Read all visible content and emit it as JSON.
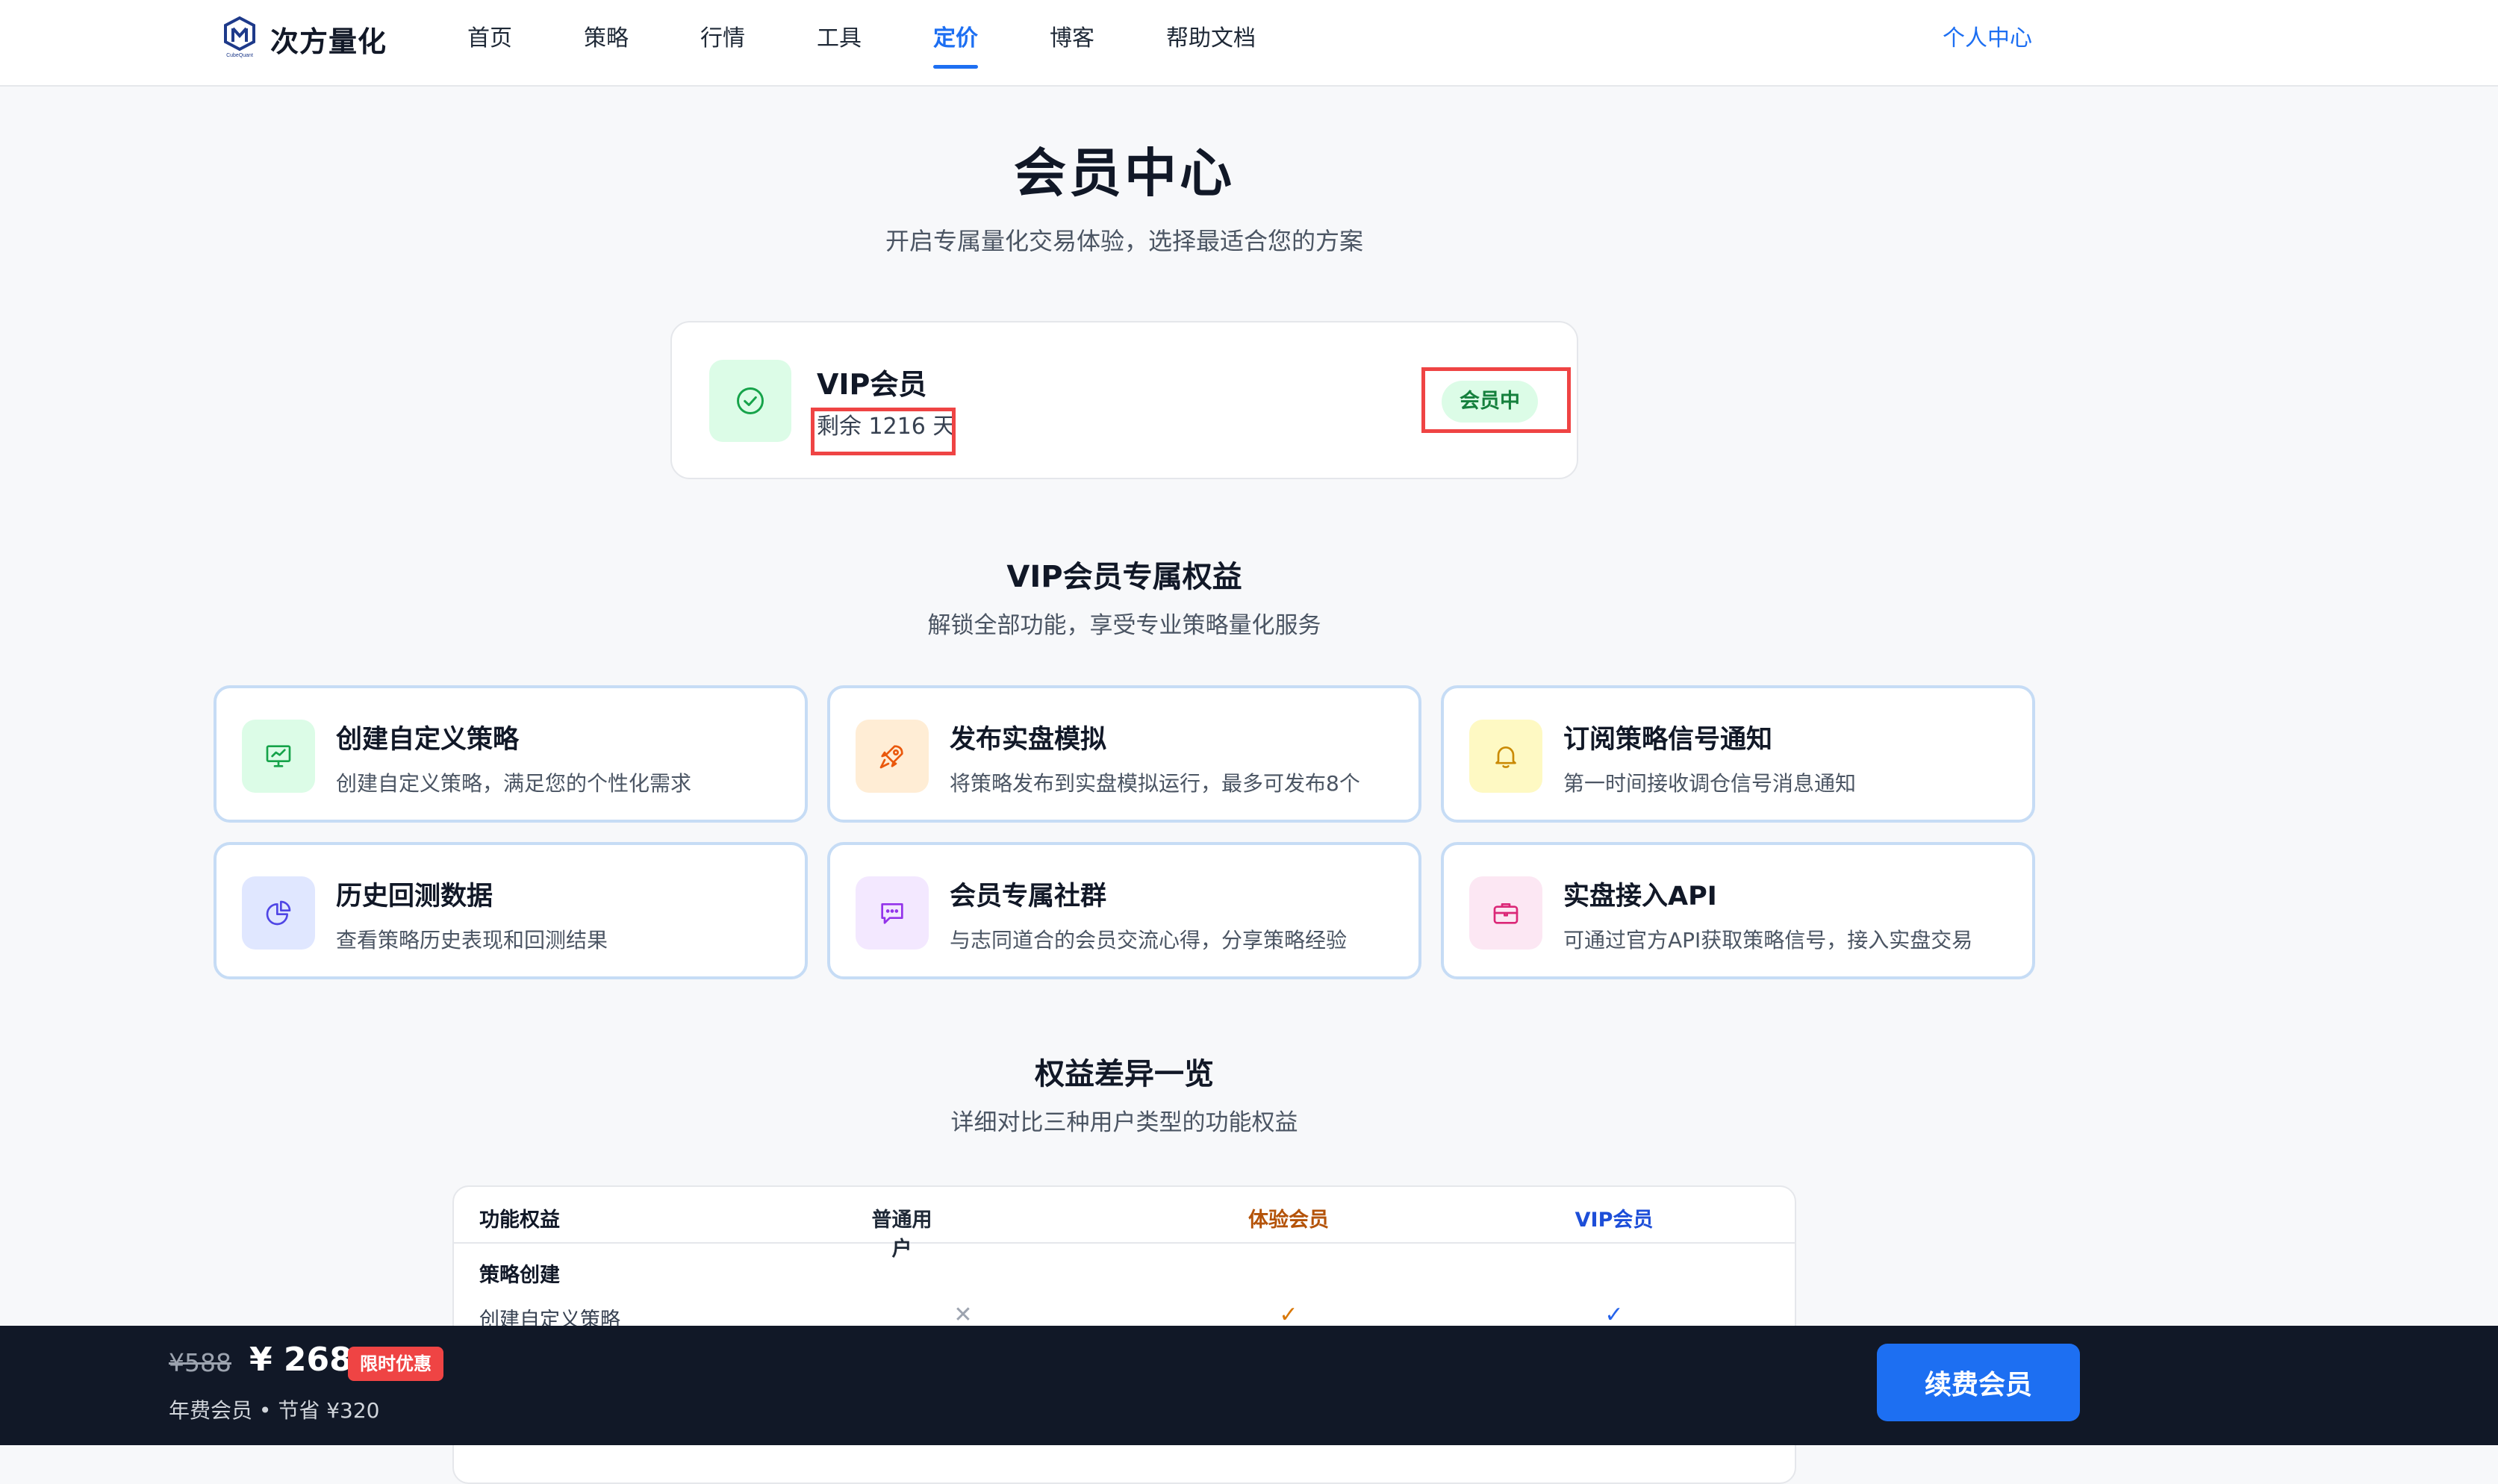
{
  "brand": {
    "name": "次方量化",
    "logo_caption": "CubeQuant",
    "accent_color": "#1d6ff2"
  },
  "nav": {
    "items": [
      {
        "label": "首页"
      },
      {
        "label": "策略"
      },
      {
        "label": "行情"
      },
      {
        "label": "工具"
      },
      {
        "label": "定价",
        "active": true
      },
      {
        "label": "博客"
      },
      {
        "label": "帮助文档"
      }
    ],
    "user_center": "个人中心"
  },
  "hero": {
    "title": "会员中心",
    "subtitle": "开启专属量化交易体验，选择最适合您的方案"
  },
  "membership": {
    "icon": "check-circle-icon",
    "name": "VIP会员",
    "remaining": "剩余 1216 天",
    "status": "会员中",
    "status_color": "#15803d"
  },
  "benefits_section": {
    "title": "VIP会员专属权益",
    "subtitle": "解锁全部功能，享受专业策略量化服务",
    "items": [
      {
        "icon": "presentation-chart-icon",
        "title": "创建自定义策略",
        "desc": "创建自定义策略，满足您的个性化需求",
        "color": "#16a34a",
        "bg": "#dcfce7"
      },
      {
        "icon": "rocket-icon",
        "title": "发布实盘模拟",
        "desc": "将策略发布到实盘模拟运行，最多可发布8个",
        "color": "#ea580c",
        "bg": "#ffedd5"
      },
      {
        "icon": "bell-icon",
        "title": "订阅策略信号通知",
        "desc": "第一时间接收调仓信号消息通知",
        "color": "#ca8a04",
        "bg": "#fef9c3"
      },
      {
        "icon": "pie-chart-icon",
        "title": "历史回测数据",
        "desc": "查看策略历史表现和回测结果",
        "color": "#4f46e5",
        "bg": "#e0e7ff"
      },
      {
        "icon": "chat-bubble-icon",
        "title": "会员专属社群",
        "desc": "与志同道合的会员交流心得，分享策略经验",
        "color": "#9333ea",
        "bg": "#f3e8ff"
      },
      {
        "icon": "briefcase-icon",
        "title": "实盘接入API",
        "desc": "可通过官方API获取策略信号，接入实盘交易",
        "color": "#db2777",
        "bg": "#fce7f3"
      }
    ]
  },
  "comparison": {
    "title": "权益差异一览",
    "subtitle": "详细对比三种用户类型的功能权益",
    "columns": [
      "功能权益",
      "普通用户",
      "体验会员",
      "VIP会员"
    ],
    "group": "策略创建",
    "rows": [
      {
        "label": "创建自定义策略",
        "normal": "✕",
        "trial": "✓",
        "vip": "✓"
      }
    ]
  },
  "bottom_bar": {
    "old_price": "¥588",
    "new_price": "¥ 268",
    "promo": "限时优惠",
    "note": "年费会员 • 节省 ¥320",
    "cta": "续费会员"
  }
}
